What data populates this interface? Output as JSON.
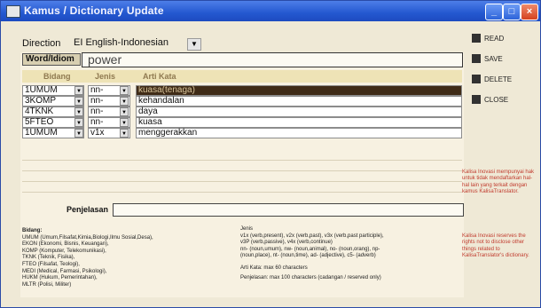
{
  "title": "Kamus / Dictionary Update",
  "direction": {
    "label": "Direction",
    "value": "EI English-Indonesian"
  },
  "word": {
    "label": "Word/Idiom",
    "value": "power"
  },
  "headers": {
    "bidang": "Bidang",
    "jenis": "Jenis",
    "arti": "Arti Kata"
  },
  "rows": [
    {
      "bidang": "1UMUM",
      "jenis": "nn-",
      "arti": "kuasa(tenaga)"
    },
    {
      "bidang": "3KOMP",
      "jenis": "nn-",
      "arti": "kehandalan"
    },
    {
      "bidang": "4TKNK",
      "jenis": "nn-",
      "arti": "daya"
    },
    {
      "bidang": "5FTEO",
      "jenis": "nn-",
      "arti": "kuasa"
    },
    {
      "bidang": "1UMUM",
      "jenis": "v1x",
      "arti": "menggerakkan"
    }
  ],
  "penjelasan_label": "Penjelasan",
  "buttons": {
    "read": "READ",
    "save": "SAVE",
    "delete": "DELETE",
    "close": "CLOSE"
  },
  "notes_bidang": [
    "Bidang:",
    "UMUM (Umum,Filsafat,Kimia,Biologi,Ilmu Sosial,Desa),",
    "EKON (Ekonomi, Bisnis, Keuangan),",
    "KOMP (Komputer, Telekomunikasi),",
    "TKNK (Teknik, Fisika),",
    "FTEO (Filsafat, Teologi),",
    "MEDI (Medical, Farmasi, Psikologi),",
    "HUKM (Hukum, Pemerintahan),",
    "MLTR (Polisi, Militer)"
  ],
  "notes_jenis": [
    "Jenis",
    "v1x (verb,present), v2x (verb,past), v3x (verb,past participle),",
    "v3P (verb,passive), v4x (verb,continue)",
    "nn- (noun,umum), nw- (noun,animal), no- (noun,orang), np-",
    "(noun,place), nt- (noun,time), ad- (adjective), c5- (adverb)",
    "Arti Kata: max 60 characters",
    "Penjelasan: max 100 characters (cadangan / reserved only)"
  ],
  "note_id": "Kalisa Inovasi mempunyai hak untuk tidak mendaftarkan hal-hal lain yang terkait dengan kamus KalisaTranslator.",
  "note_en": "Kalisa Inovasi reserves the rights not to disclose other things related to KalisaTranslator's dictionary."
}
